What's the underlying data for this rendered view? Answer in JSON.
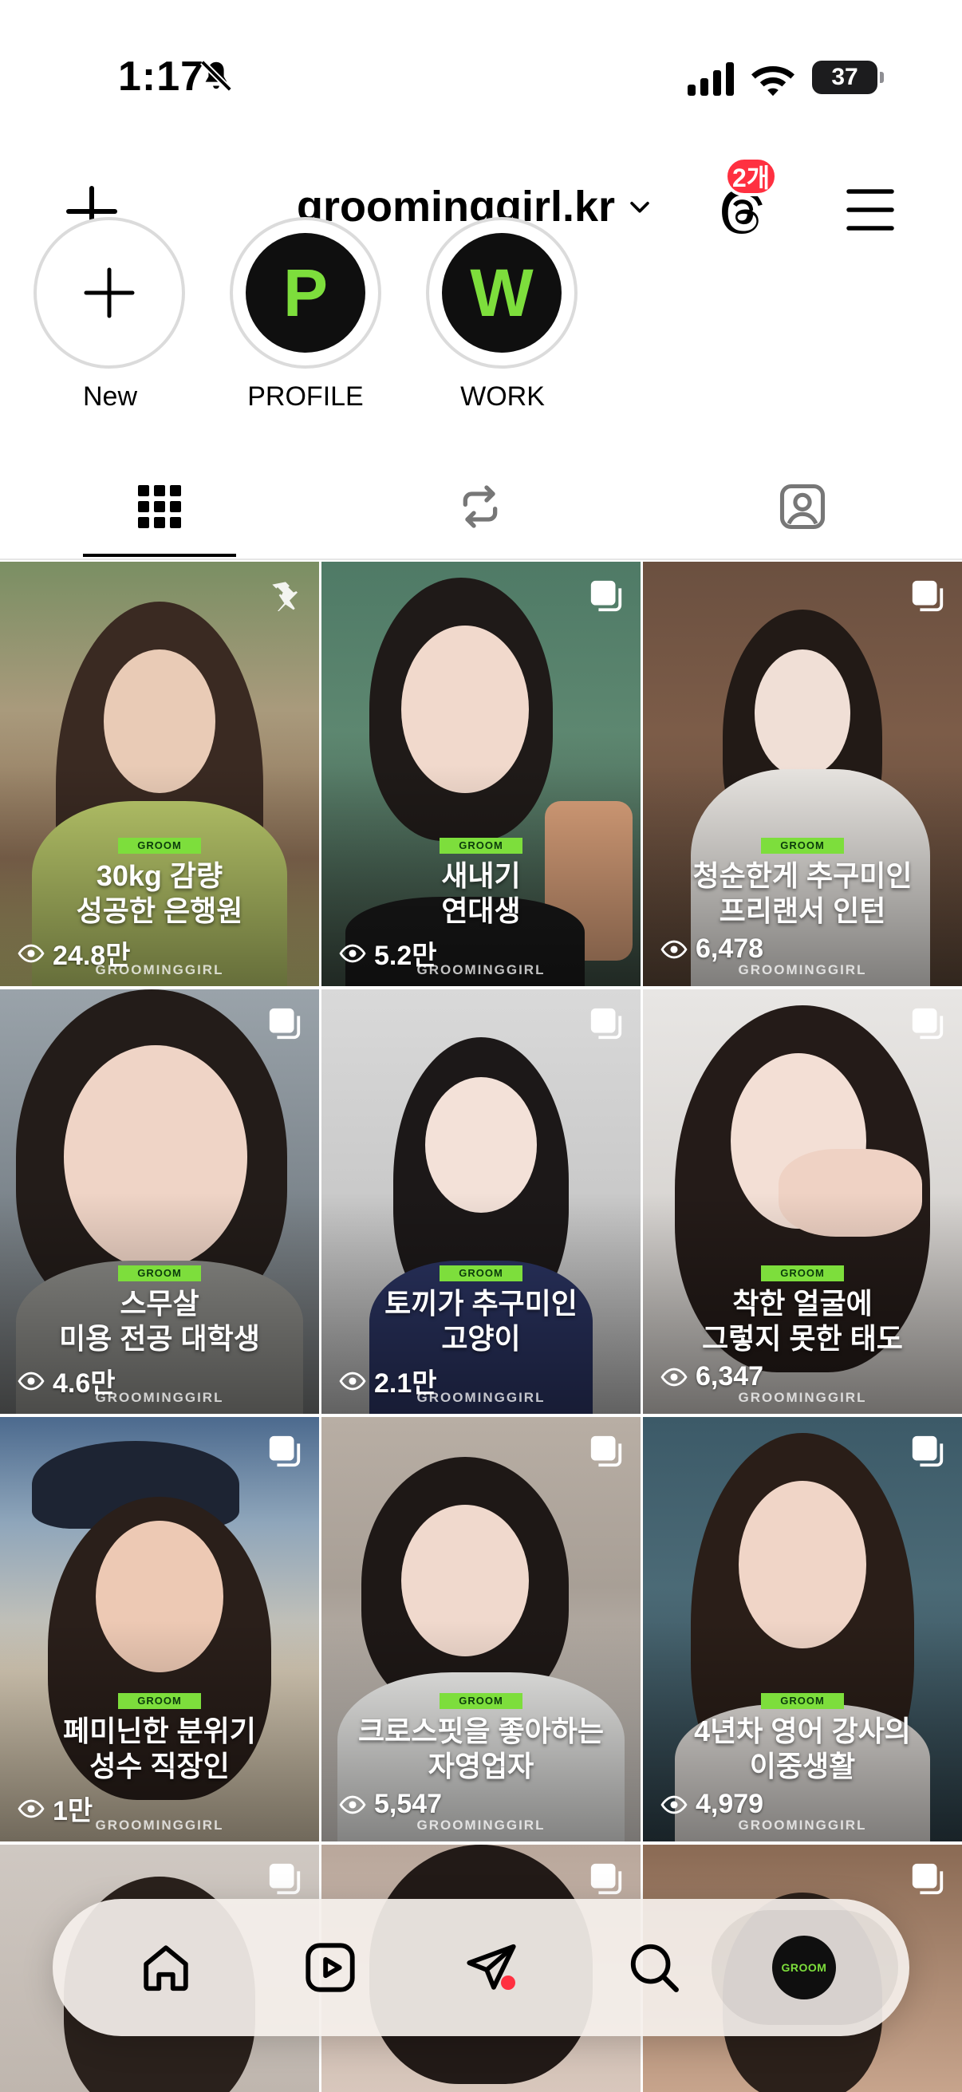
{
  "status_bar": {
    "time": "1:17",
    "battery": "37"
  },
  "header": {
    "username": "groominggirl.kr",
    "threads_badge": "2개"
  },
  "highlights": [
    {
      "label": "New",
      "glyph": "+"
    },
    {
      "label": "PROFILE",
      "glyph": "P"
    },
    {
      "label": "WORK",
      "glyph": "W"
    }
  ],
  "tabs": [
    "grid-icon",
    "reposts-icon",
    "tagged-icon"
  ],
  "grid": {
    "tag": "GROOM",
    "watermark": "GROOMINGGIRL",
    "posts": [
      {
        "caption1": "30kg 감량",
        "caption2": "성공한 은행원",
        "views": "24.8만",
        "overlay": "pin"
      },
      {
        "caption1": "새내기",
        "caption2": "연대생",
        "views": "5.2만",
        "overlay": "multi"
      },
      {
        "caption1": "청순한게 추구미인",
        "caption2": "프리랜서 인턴",
        "views": "6,478",
        "overlay": "multi"
      },
      {
        "caption1": "스무살",
        "caption2": "미용 전공 대학생",
        "views": "4.6만",
        "overlay": "multi"
      },
      {
        "caption1": "토끼가 추구미인",
        "caption2": "고양이",
        "views": "2.1만",
        "overlay": "multi"
      },
      {
        "caption1": "착한 얼굴에",
        "caption2": "그렇지 못한 태도",
        "views": "6,347",
        "overlay": "multi"
      },
      {
        "caption1": "페미닌한 분위기",
        "caption2": "성수 직장인",
        "views": "1만",
        "overlay": "multi"
      },
      {
        "caption1": "크로스핏을 좋아하는",
        "caption2": "자영업자",
        "views": "5,547",
        "overlay": "multi"
      },
      {
        "caption1": "4년차 영어 강사의",
        "caption2": "이중생활",
        "views": "4,979",
        "overlay": "multi"
      }
    ]
  },
  "bottom_nav": {
    "items": [
      "home-icon",
      "reels-icon",
      "direct-icon",
      "search-icon",
      "profile-avatar"
    ],
    "avatar_text": "GROOM"
  },
  "colors": {
    "accent_green": "#7dde3c",
    "badge_red": "#ff3040",
    "avatar_dark": "#0f0f0f"
  }
}
